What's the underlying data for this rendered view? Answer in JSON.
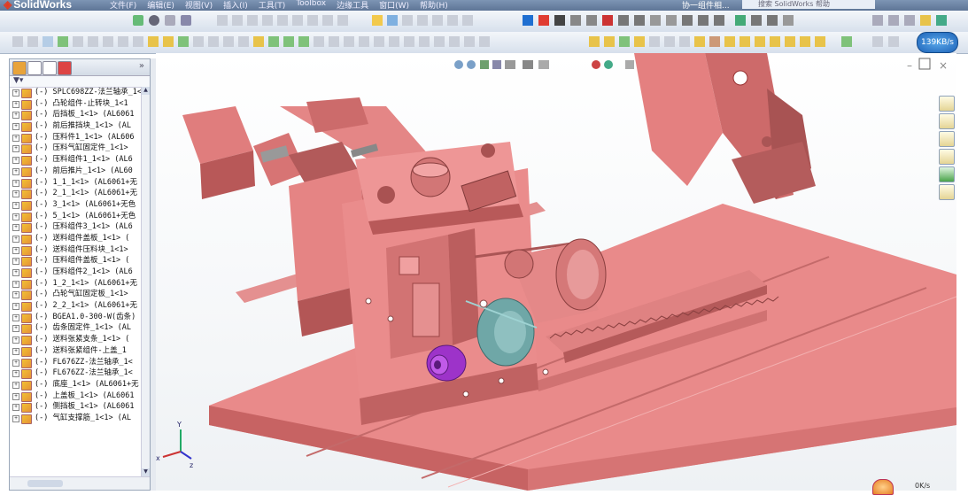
{
  "app": {
    "name": "SolidWorks",
    "menu": [
      "文件(F)",
      "编辑(E)",
      "视图(V)",
      "插入(I)",
      "工具(T)",
      "Toolbox",
      "边缘工具",
      "窗口(W)",
      "帮助(H)"
    ],
    "search_placeholder": "搜索 SolidWorks 帮助",
    "tab_label": "协一组件相..."
  },
  "overlay": {
    "speed": "139KB/s",
    "net_down": "0K/s"
  },
  "tree": {
    "filter_icon": "filter-icon",
    "items": [
      "(-) SPLC698ZZ-法兰轴承_1<",
      "(-) 凸轮组件-止转块_1<1",
      "(-) 后挡板_1<1> (AL6061",
      "(-) 前后推挡块_1<1> (AL",
      "(-) 压料件1_1<1> (AL606",
      "(-) 压料气缸固定件_1<1>",
      "(-) 压料组件1_1<1> (AL6",
      "(-) 前后推片_1<1> (AL60",
      "(-) 1_1_1<1> (AL6061+无",
      "(-) 2_1_1<1> (AL6061+无",
      "(-) 3_1<1> (AL6061+无色",
      "(-) 5_1<1> (AL6061+无色",
      "(-) 压料组件3_1<1> (AL6",
      "(-) 送料组件盖板_1<1> (",
      "(-) 送料组件压料块_1<1>",
      "(-) 压料组件盖板_1<1> (",
      "(-) 压料组件2_1<1> (AL6",
      "(-) 1_2_1<1> (AL6061+无",
      "(-) 凸轮气缸固定板_1<1>",
      "(-) 2_2_1<1> (AL6061+无",
      "(-) BGEA1.0-300-W(齿条)",
      "(-) 齿条固定件_1<1> (AL",
      "(-) 送料张紧支条_1<1> (",
      "(-) 送料张紧组件-上盖_1",
      "(-) FL676ZZ-法兰轴承_1<",
      "(-) FL676ZZ-法兰轴承_1<",
      "(-) 底座_1<1> (AL6061+无",
      "(-) 上盖板_1<1> (AL6061",
      "(-) 侧挡板_1<1> (AL6061",
      "(-) 气缸支撑筋_1<1> (AL"
    ]
  },
  "colors": {
    "part": "#e88585",
    "part_dark": "#b85858",
    "part_light": "#f3a3a3",
    "cam": "#6fa7a7",
    "purple": "#9d33c9"
  }
}
